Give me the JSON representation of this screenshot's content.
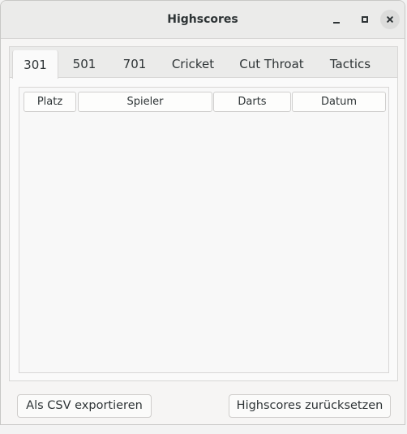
{
  "window": {
    "title": "Highscores"
  },
  "tabs": [
    {
      "label": "301",
      "active": true
    },
    {
      "label": "501",
      "active": false
    },
    {
      "label": "701",
      "active": false
    },
    {
      "label": "Cricket",
      "active": false
    },
    {
      "label": "Cut Throat",
      "active": false
    },
    {
      "label": "Tactics",
      "active": false
    }
  ],
  "table": {
    "columns": [
      "Platz",
      "Spieler",
      "Darts",
      "Datum"
    ],
    "rows": []
  },
  "buttons": {
    "export_label": "Als CSV exportieren",
    "reset_label": "Highscores zurücksetzen"
  },
  "icons": {
    "minimize": "minimize-icon",
    "maximize": "maximize-icon",
    "close": "close-icon"
  }
}
